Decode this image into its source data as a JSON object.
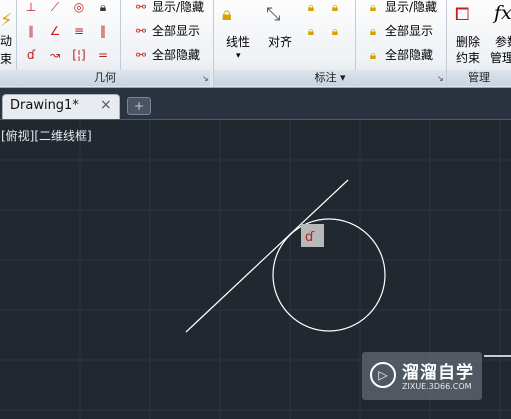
{
  "ribbon": {
    "panels": [
      {
        "title": "几何",
        "expander": "↘"
      },
      {
        "title": "标注 ▾",
        "expander": "↘"
      },
      {
        "title": "管理"
      }
    ],
    "left_partial_label": {
      "line1": "动",
      "line2": "束"
    },
    "geometry_commands": [
      "显示/隐藏",
      "全部显示",
      "全部隐藏"
    ],
    "dimension_buttons": {
      "linear": "线性",
      "linear_dropdown": "▾",
      "aligned": "对齐"
    },
    "dimension_commands": [
      "显示/隐藏",
      "全部显示",
      "全部隐藏"
    ],
    "manage": {
      "delete_line1": "删除",
      "delete_line2": "约束",
      "param_line1": "参数",
      "param_line2": "管理",
      "fx": "fx"
    }
  },
  "document_tab": {
    "title": "Drawing1*",
    "close": "×",
    "new_tab_icon": "+"
  },
  "viewport": {
    "label": "[俯视][二维线框]"
  },
  "colors": {
    "canvas": "#212830",
    "grid": "#2c3540",
    "geometry": "#ffffff",
    "marker": "#b8b8b8"
  },
  "watermark": {
    "title": "溜溜自学",
    "url": "ZIXUE.3D66.COM",
    "logo": "▷"
  }
}
